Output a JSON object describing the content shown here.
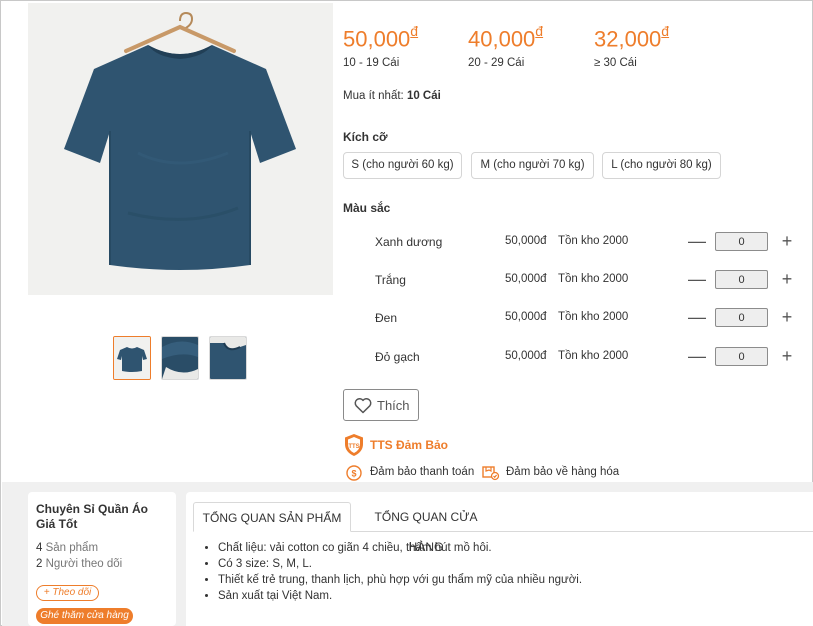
{
  "product": {
    "image_alt": "Áo thun xanh navy",
    "thumbnails": [
      "thumb-1",
      "thumb-2",
      "thumb-3"
    ]
  },
  "price_tiers": [
    {
      "price": "50,000",
      "currency": "đ",
      "qty": "10 - 19 Cái"
    },
    {
      "price": "40,000",
      "currency": "đ",
      "qty": "20 - 29 Cái"
    },
    {
      "price": "32,000",
      "currency": "đ",
      "qty": "≥ 30 Cái"
    }
  ],
  "min_order": {
    "label": "Mua ít nhất:",
    "value": "10 Cái"
  },
  "sizes": {
    "label": "Kích cỡ",
    "options": [
      "S (cho người 60 kg)",
      "M (cho người 70 kg)",
      "L (cho người 80 kg)"
    ]
  },
  "colors": {
    "label": "Màu sắc",
    "rows": [
      {
        "name": "Xanh dương",
        "price": "50,000đ",
        "stock": "Tồn kho 2000",
        "qty": "0"
      },
      {
        "name": "Trắng",
        "price": "50,000đ",
        "stock": "Tồn kho 2000",
        "qty": "0"
      },
      {
        "name": "Đen",
        "price": "50,000đ",
        "stock": "Tồn kho 2000",
        "qty": "0"
      },
      {
        "name": "Đỏ gạch",
        "price": "50,000đ",
        "stock": "Tồn kho 2000",
        "qty": "0"
      }
    ],
    "minus_symbol": "—",
    "plus_symbol": "+"
  },
  "like_button": {
    "label": "Thích",
    "icon": "heart-icon"
  },
  "guarantee": {
    "title": "TTS Đảm Bảo",
    "badge_text": "TTS",
    "items": [
      {
        "icon": "payment-shield-icon",
        "label": "Đảm bảo thanh toán"
      },
      {
        "icon": "goods-box-icon",
        "label": "Đảm bảo về hàng hóa"
      }
    ]
  },
  "shop": {
    "name": "Chuyên Sỉ Quần Áo Giá Tốt",
    "products_count": "4",
    "products_label": "Sản phẩm",
    "followers_count": "2",
    "followers_label": "Người theo dõi",
    "follow_label": "+ Theo dõi",
    "visit_label": "Ghé thăm cửa hàng"
  },
  "tabs": [
    {
      "label": "TỔNG QUAN SẢN PHẨM",
      "active": true
    },
    {
      "label": "TỔNG QUAN CỬA HÀNG",
      "active": false
    }
  ],
  "description": [
    "Chất liệu: vải cotton co giãn 4 chiều, thấm hút mồ hôi.",
    "Có 3 size: S, M, L.",
    "Thiết kế trẻ trung, thanh lịch, phù hợp với gu thẩm mỹ của nhiều người.",
    "Sản xuất tại Việt Nam."
  ],
  "colors_theme": {
    "accent": "#ee7d2b",
    "shirt": "#2f5470"
  }
}
